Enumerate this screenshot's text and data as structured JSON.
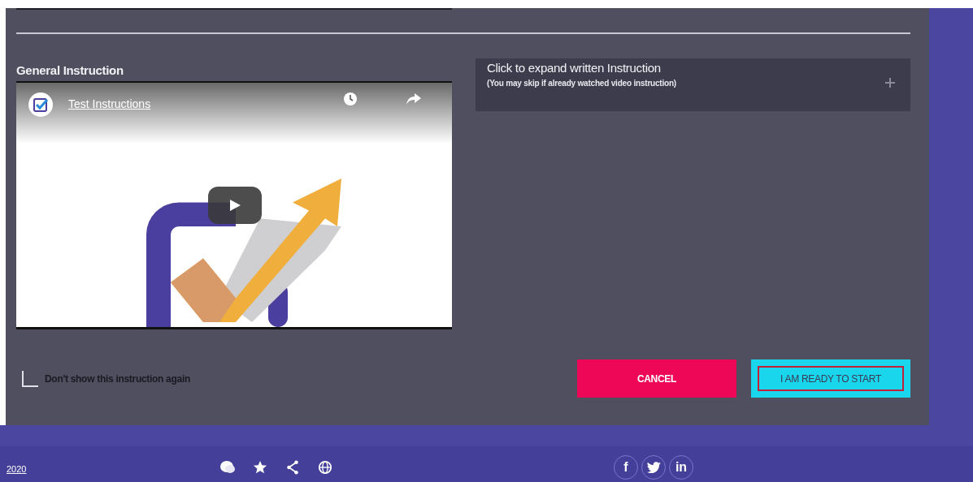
{
  "section_title": "General Instruction",
  "video": {
    "kind": "picture",
    "channel_title": "Test Instructions"
  },
  "expand_panel": {
    "title": "Click to expand written Instruction",
    "subtitle": "(You may skip if already watched video instruction)",
    "expanded": false
  },
  "dont_show": {
    "label": "Don't show this instruction again",
    "checked": false
  },
  "buttons": [
    {
      "kind": "cancel",
      "label": "CANCEL",
      "focused": false
    },
    {
      "kind": "start",
      "label": "I AM READY TO START",
      "focused": true
    }
  ],
  "footer": {
    "year": "2020",
    "social": [
      {
        "kind": "facebook",
        "glyph": "f"
      },
      {
        "kind": "twitter"
      },
      {
        "kind": "linkedin",
        "glyph": "in"
      }
    ]
  }
}
